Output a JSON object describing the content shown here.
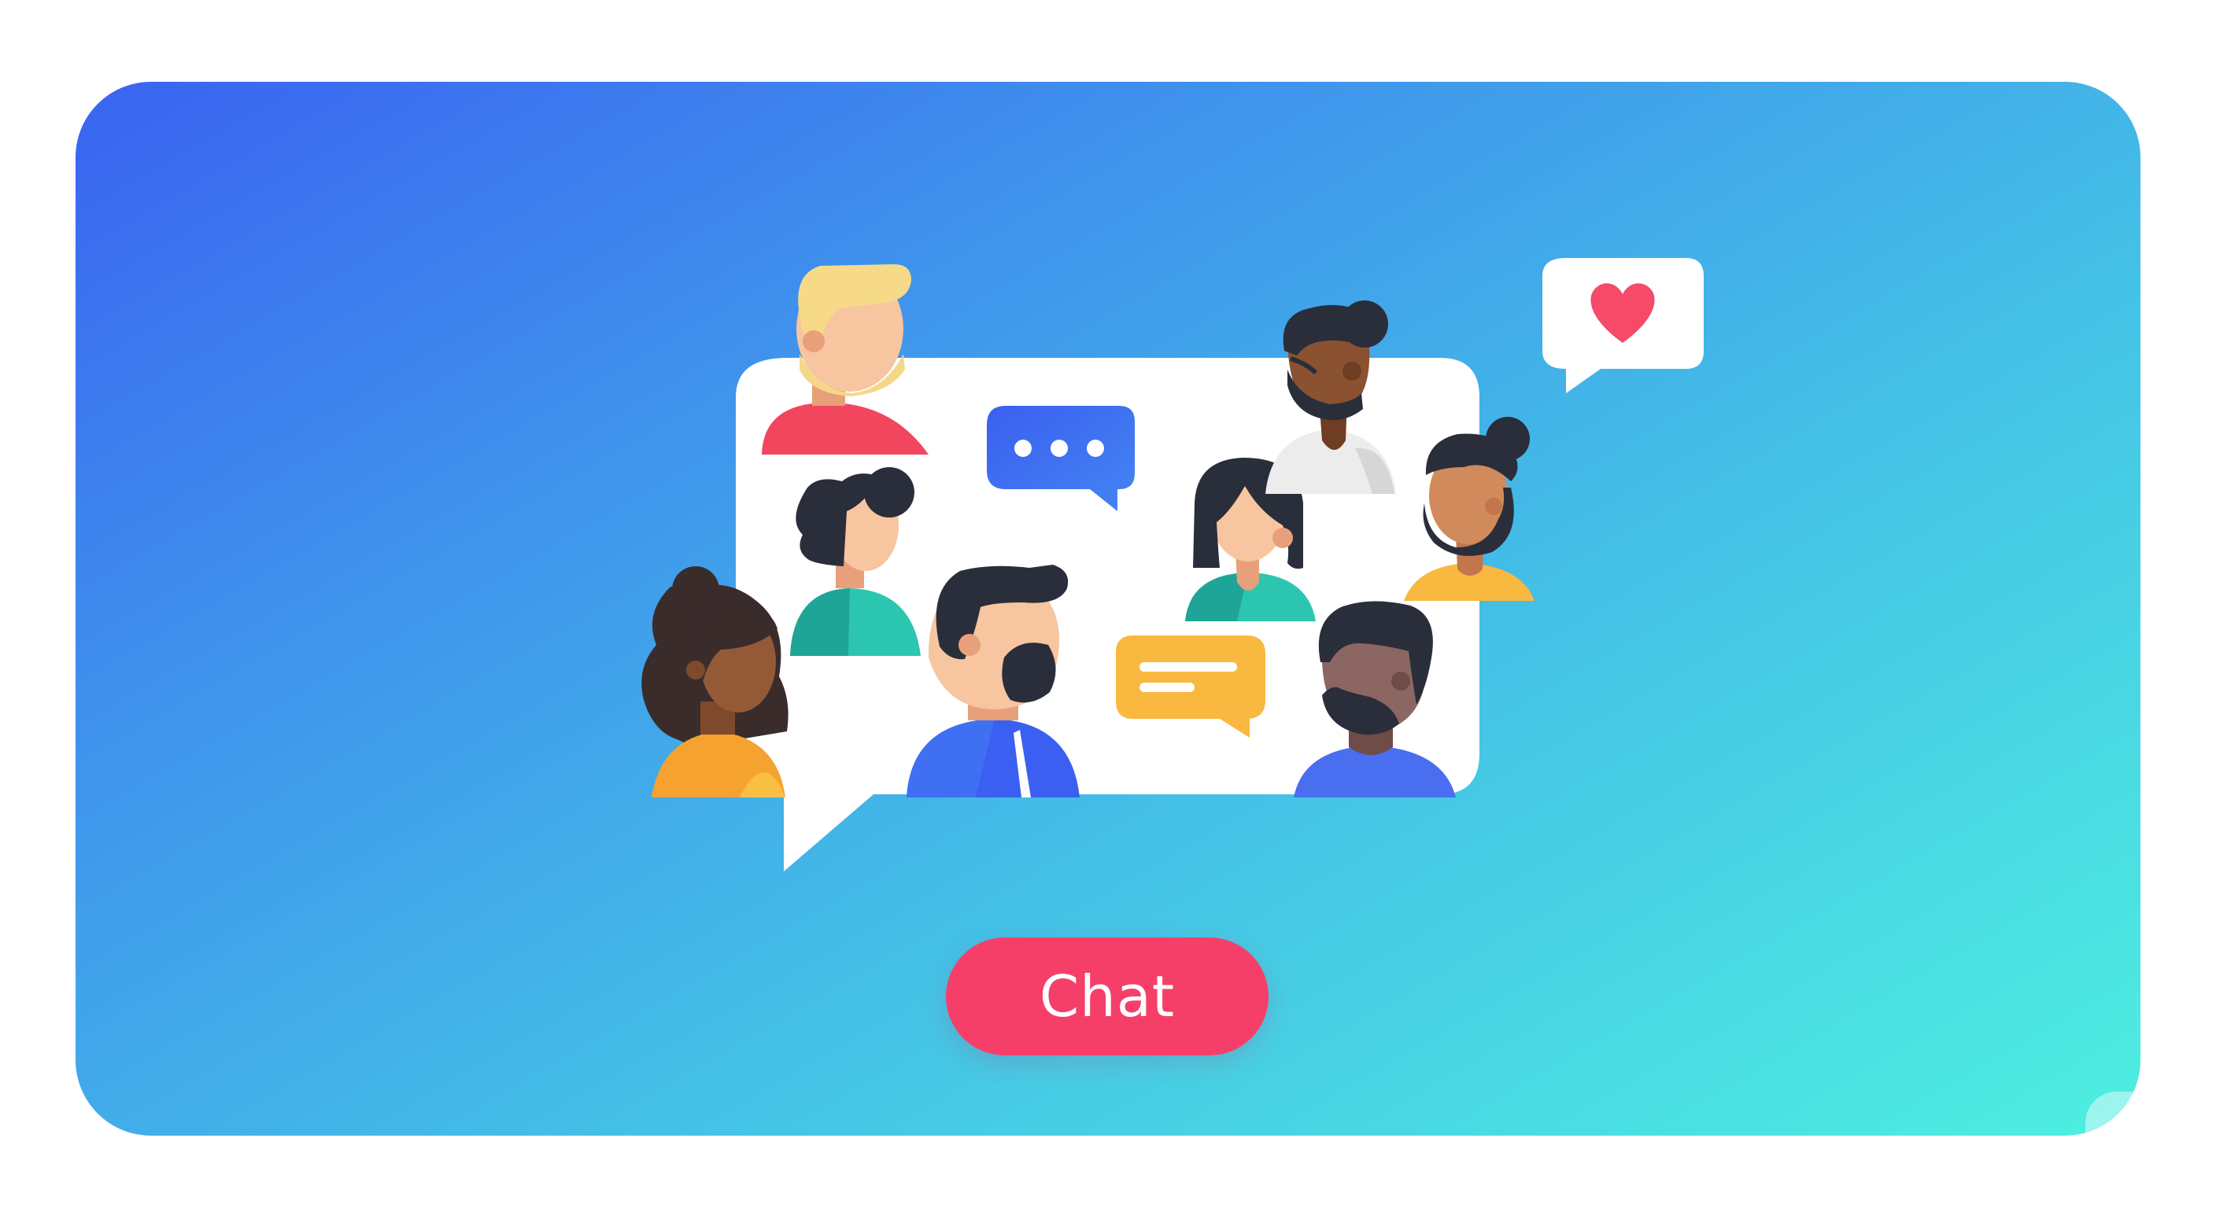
{
  "cta": {
    "label": "Chat"
  },
  "icons": [
    "speech-bubble-icon",
    "typing-dots-icon",
    "message-lines-icon",
    "heart-icon"
  ],
  "colors": {
    "gradient_start": "#3a63f1",
    "gradient_end": "#4eefe0",
    "button": "#f53f69",
    "heart": "#f54a6a",
    "typing_bubble": "#3d6cf0",
    "message_bubble": "#f9b840"
  }
}
